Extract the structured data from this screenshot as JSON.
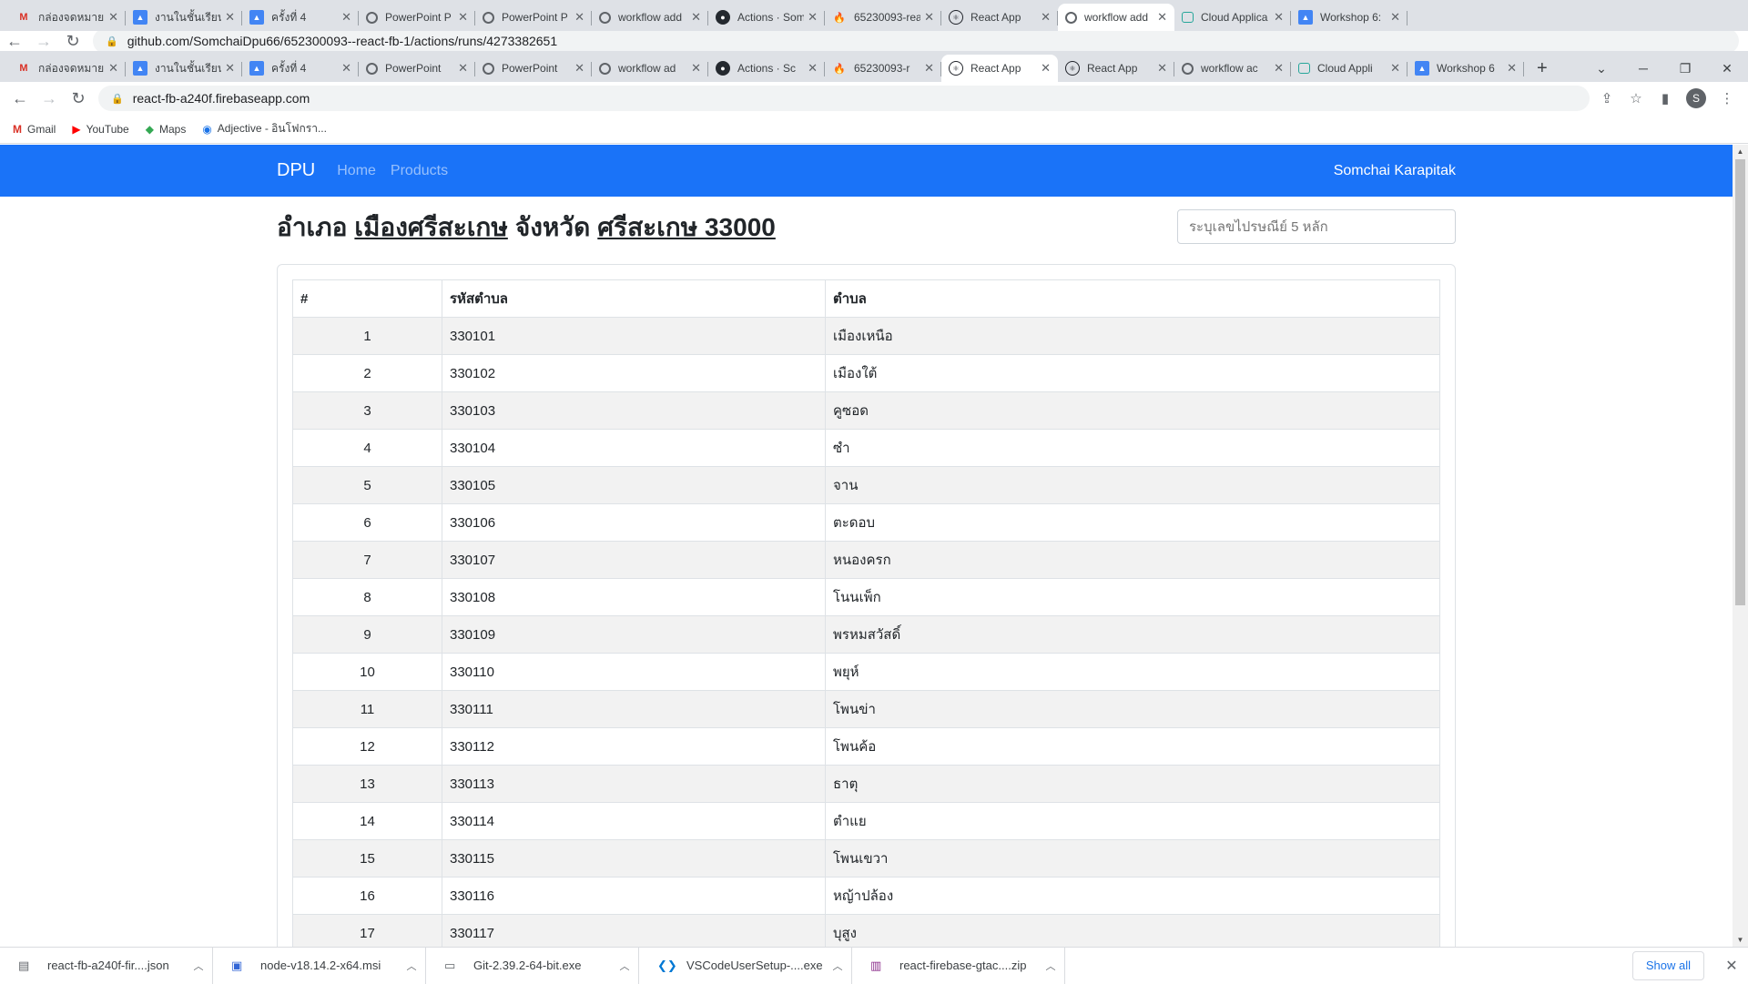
{
  "back_window": {
    "tabs": [
      {
        "title": "กล่องจดหมาย (",
        "icon": "gmail"
      },
      {
        "title": "งานในชั้นเรียน",
        "icon": "doc"
      },
      {
        "title": "ครั้งที่ 4",
        "icon": "doc"
      },
      {
        "title": "PowerPoint P",
        "icon": "ring"
      },
      {
        "title": "PowerPoint P",
        "icon": "ring"
      },
      {
        "title": "workflow add",
        "icon": "ring"
      },
      {
        "title": "Actions · Som",
        "icon": "gh"
      },
      {
        "title": "65230093-rea",
        "icon": "fire"
      },
      {
        "title": "React App",
        "icon": "react"
      },
      {
        "title": "workflow add",
        "icon": "ring",
        "active": true
      },
      {
        "title": "Cloud Applica",
        "icon": "cloud"
      },
      {
        "title": "Workshop 6:",
        "icon": "doc"
      }
    ],
    "url": "github.com/SomchaiDpu66/652300093--react-fb-1/actions/runs/4273382651"
  },
  "tabs": [
    {
      "title": "กล่องจดหมาย",
      "icon": "gmail"
    },
    {
      "title": "งานในชั้นเรียน",
      "icon": "doc"
    },
    {
      "title": "ครั้งที่ 4",
      "icon": "doc"
    },
    {
      "title": "PowerPoint",
      "icon": "ring"
    },
    {
      "title": "PowerPoint",
      "icon": "ring"
    },
    {
      "title": "workflow ad",
      "icon": "ring"
    },
    {
      "title": "Actions · Sc",
      "icon": "gh"
    },
    {
      "title": "65230093-r",
      "icon": "fire"
    },
    {
      "title": "React App",
      "icon": "react",
      "active": true
    },
    {
      "title": "React App",
      "icon": "react"
    },
    {
      "title": "workflow ac",
      "icon": "ring"
    },
    {
      "title": "Cloud Appli",
      "icon": "cloud"
    },
    {
      "title": "Workshop 6",
      "icon": "doc"
    }
  ],
  "url": "react-fb-a240f.firebaseapp.com",
  "bookmarks": [
    {
      "label": "Gmail",
      "icon": "gmail"
    },
    {
      "label": "YouTube",
      "icon": "youtube"
    },
    {
      "label": "Maps",
      "icon": "maps"
    },
    {
      "label": "Adjective - อินโฟกรา...",
      "icon": "globe"
    }
  ],
  "profile_initial": "S",
  "app": {
    "brand": "DPU",
    "nav": [
      "Home",
      "Products"
    ],
    "user": "Somchai Karapitak",
    "heading_prefix_amphoe": "อำเภอ",
    "amphoe": "เมืองศรีสะเกษ",
    "heading_prefix_province": "จังหวัด",
    "province_zip": "ศรีสะเกษ 33000",
    "zip_placeholder": "ระบุเลขไปรษณีย์ 5 หลัก",
    "table_headers": [
      "#",
      "รหัสตำบล",
      "ตำบล"
    ],
    "rows": [
      {
        "no": "1",
        "code": "330101",
        "name": "เมืองเหนือ"
      },
      {
        "no": "2",
        "code": "330102",
        "name": "เมืองใต้"
      },
      {
        "no": "3",
        "code": "330103",
        "name": "คูซอด"
      },
      {
        "no": "4",
        "code": "330104",
        "name": "ซำ"
      },
      {
        "no": "5",
        "code": "330105",
        "name": "จาน"
      },
      {
        "no": "6",
        "code": "330106",
        "name": "ตะดอบ"
      },
      {
        "no": "7",
        "code": "330107",
        "name": "หนองครก"
      },
      {
        "no": "8",
        "code": "330108",
        "name": "โนนเพ็ก"
      },
      {
        "no": "9",
        "code": "330109",
        "name": "พรหมสวัสดิ์"
      },
      {
        "no": "10",
        "code": "330110",
        "name": "พยุห์"
      },
      {
        "no": "11",
        "code": "330111",
        "name": "โพนข่า"
      },
      {
        "no": "12",
        "code": "330112",
        "name": "โพนค้อ"
      },
      {
        "no": "13",
        "code": "330113",
        "name": "ธาตุ"
      },
      {
        "no": "14",
        "code": "330114",
        "name": "ตำแย"
      },
      {
        "no": "15",
        "code": "330115",
        "name": "โพนเขวา"
      },
      {
        "no": "16",
        "code": "330116",
        "name": "หญ้าปล้อง"
      },
      {
        "no": "17",
        "code": "330117",
        "name": "บุสูง"
      }
    ]
  },
  "downloads": [
    {
      "name": "react-fb-a240f-fir....json",
      "icon": "file"
    },
    {
      "name": "node-v18.14.2-x64.msi",
      "icon": "installer"
    },
    {
      "name": "Git-2.39.2-64-bit.exe",
      "icon": "exe"
    },
    {
      "name": "VSCodeUserSetup-....exe",
      "icon": "vscode"
    },
    {
      "name": "react-firebase-gtac....zip",
      "icon": "zip"
    }
  ],
  "show_all_label": "Show all"
}
